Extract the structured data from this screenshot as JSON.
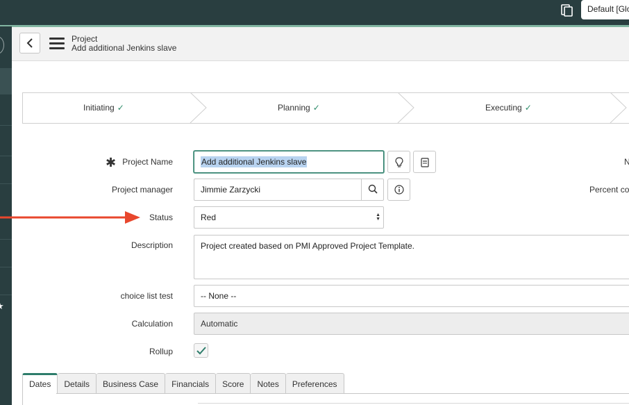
{
  "banner": {
    "scope_label": "Default [Glo"
  },
  "header": {
    "table_label": "Project",
    "record_label": "Add additional Jenkins slave"
  },
  "process_flow": [
    {
      "label": "Initiating",
      "check": "✓"
    },
    {
      "label": "Planning",
      "check": "✓"
    },
    {
      "label": "Executing",
      "check": "✓"
    }
  ],
  "form": {
    "required_mark": "✱",
    "project_name": {
      "label": "Project Name",
      "value": "Add additional Jenkins slave"
    },
    "project_manager": {
      "label": "Project manager",
      "value": "Jimmie Zarzycki"
    },
    "status": {
      "label": "Status",
      "value": "Red"
    },
    "description": {
      "label": "Description",
      "value": "Project created based on PMI Approved Project Template."
    },
    "choice_list_test": {
      "label": "choice list test",
      "value": "-- None --"
    },
    "calculation": {
      "label": "Calculation",
      "value": "Automatic"
    },
    "rollup": {
      "label": "Rollup",
      "checked": true
    },
    "right_column": {
      "number_label": "N",
      "percent_label": "Percent co"
    }
  },
  "tabs": [
    {
      "label": "Dates",
      "active": true
    },
    {
      "label": "Details"
    },
    {
      "label": "Business Case"
    },
    {
      "label": "Financials"
    },
    {
      "label": "Score"
    },
    {
      "label": "Notes"
    },
    {
      "label": "Preferences"
    }
  ],
  "colors": {
    "banner": "#293e40",
    "accent": "#81b5a1",
    "check": "#2b8a68",
    "focus": "#2e7d6b",
    "annotation_arrow": "#e8472d"
  },
  "icons": {
    "scope": "document-stack-icon",
    "back": "chevron-left-icon",
    "menu": "hamburger-icon",
    "suggest": "lightbulb-icon",
    "template": "clipboard-icon",
    "lookup": "search-icon",
    "info": "info-icon",
    "select": "select-arrows-icon",
    "checkbox": "checkmark-icon"
  }
}
